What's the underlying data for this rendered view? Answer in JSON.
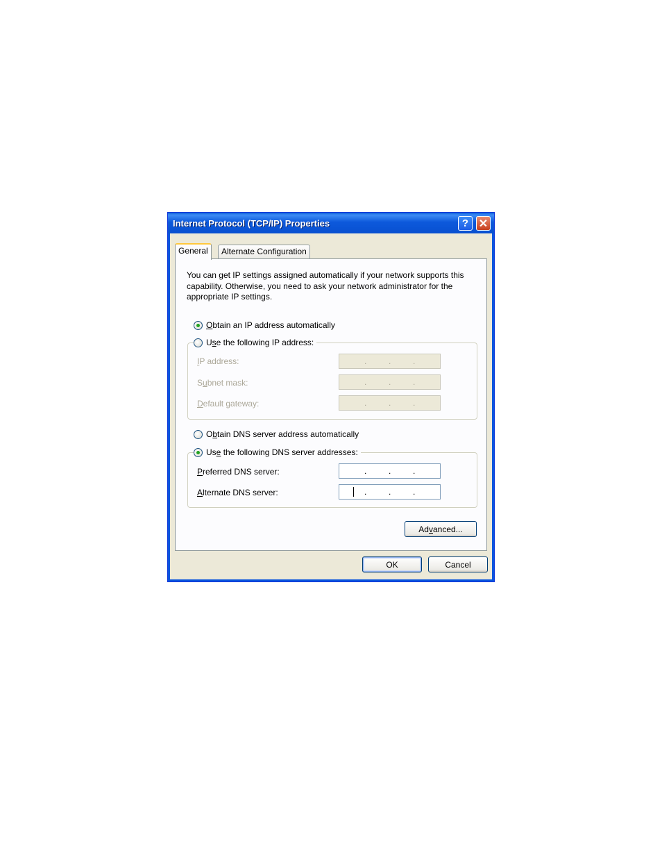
{
  "window": {
    "title": "Internet Protocol (TCP/IP) Properties",
    "help_glyph": "?",
    "close_glyph": "✕"
  },
  "tabs": [
    {
      "label": "General",
      "active": true
    },
    {
      "label": "Alternate Configuration",
      "active": false
    }
  ],
  "general": {
    "description": "You can get IP settings assigned automatically if your network supports this capability. Otherwise, you need to ask your network administrator for the appropriate IP settings.",
    "ip_auto": {
      "pre": "",
      "key": "O",
      "post": "btain an IP address automatically",
      "checked": true
    },
    "ip_manual": {
      "pre": "U",
      "key": "s",
      "post": "e the following IP address:",
      "checked": false
    },
    "ip_fields": [
      {
        "pre": "",
        "key": "I",
        "post": "P address:",
        "value": ". . ."
      },
      {
        "pre": "S",
        "key": "u",
        "post": "bnet mask:",
        "value": ". . ."
      },
      {
        "pre": "",
        "key": "D",
        "post": "efault gateway:",
        "value": ". . ."
      }
    ],
    "dns_auto": {
      "pre": "O",
      "key": "b",
      "post": "tain DNS server address automatically",
      "checked": false
    },
    "dns_manual": {
      "pre": "Us",
      "key": "e",
      "post": " the following DNS server addresses:",
      "checked": true
    },
    "dns_fields": [
      {
        "pre": "",
        "key": "P",
        "post": "referred DNS server:",
        "value": ". . ."
      },
      {
        "pre": "",
        "key": "A",
        "post": "lternate DNS server:",
        "value": ". . ."
      }
    ],
    "advanced": {
      "pre": "Ad",
      "key": "v",
      "post": "anced..."
    }
  },
  "footer": {
    "ok_label": "OK",
    "cancel_label": "Cancel"
  },
  "colors": {
    "titlebar": "#0855dd",
    "dialog_face": "#ece9d8",
    "tab_highlight": "#ffc83c",
    "radio_check": "#21a121"
  }
}
